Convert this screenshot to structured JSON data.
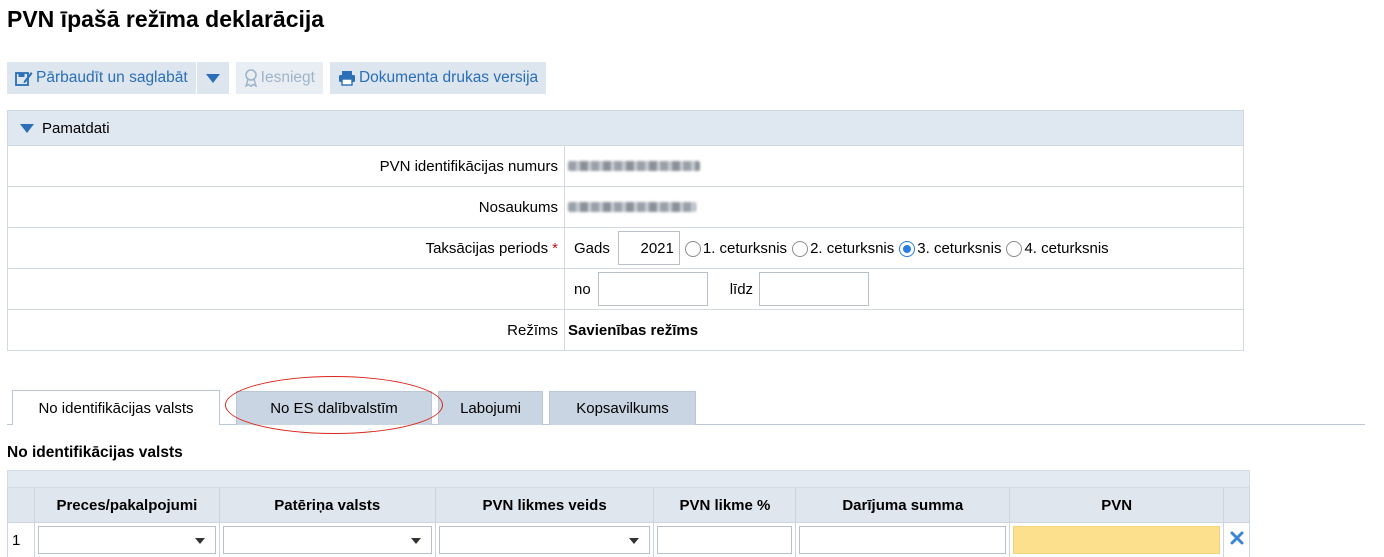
{
  "page": {
    "title": "PVN īpašā režīma deklarācija"
  },
  "toolbar": {
    "save_label": "Pārbaudīt un saglabāt",
    "submit_label": "Iesniegt",
    "print_label": "Dokumenta drukas versija"
  },
  "pamatdati": {
    "header": "Pamatdati",
    "vat_label": "PVN identifikācijas numurs",
    "name_label": "Nosaukums",
    "period_label": "Taksācijas periods",
    "required_mark": "*",
    "year_label": "Gads",
    "year_value": "2021",
    "quarters": [
      "1. ceturksnis",
      "2. ceturksnis",
      "3. ceturksnis",
      "4. ceturksnis"
    ],
    "selected_quarter": "3. ceturksnis",
    "from_label": "no",
    "to_label": "līdz",
    "mode_label": "Režīms",
    "mode_value": "Savienības režīms"
  },
  "tabs": [
    {
      "label": "No identifikācijas valsts",
      "active": true
    },
    {
      "label": "No ES dalībvalstīm",
      "active": false
    },
    {
      "label": "Labojumi",
      "active": false
    },
    {
      "label": "Kopsavilkums",
      "active": false
    }
  ],
  "section": {
    "title": "No identifikācijas valsts"
  },
  "table": {
    "columns": [
      "Preces/pakalpojumi",
      "Patēriņa valsts",
      "PVN likmes veids",
      "PVN likme %",
      "Darījuma summa",
      "PVN"
    ],
    "rows": [
      {
        "index": "1"
      }
    ]
  },
  "colors": {
    "link_blue": "#2a6fb8",
    "highlight_ring": "#d9261c",
    "pvn_cell": "#fde08e",
    "delete_icon": "#3a86d4"
  }
}
